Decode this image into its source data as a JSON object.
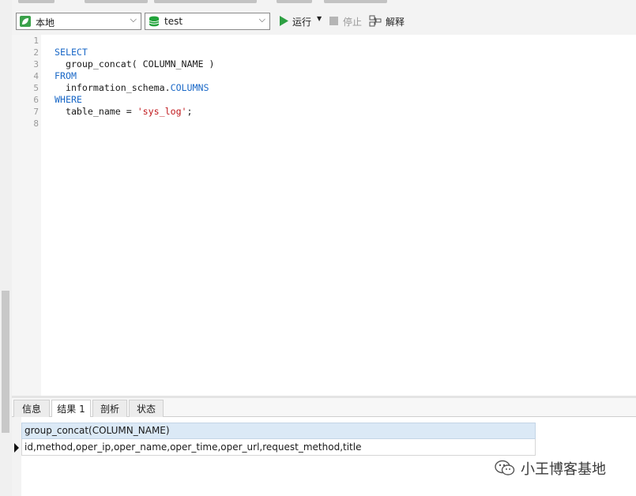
{
  "connection_select": {
    "value": "本地"
  },
  "database_select": {
    "value": "test"
  },
  "toolbar": {
    "run_label": "运行",
    "stop_label": "停止",
    "explain_label": "解释"
  },
  "editor": {
    "line_numbers": [
      "1",
      "2",
      "3",
      "4",
      "5",
      "6",
      "7",
      "8"
    ],
    "lines": {
      "l2_kw": "SELECT",
      "l3_text": "  group_concat( COLUMN_NAME )",
      "l4_kw": "FROM",
      "l5_pre": "  information_schema.",
      "l5_col": "COLUMNS",
      "l6_kw": "WHERE",
      "l7_pre": "  table_name = ",
      "l7_str": "'sys_log'",
      "l7_post": ";"
    }
  },
  "result_tabs": [
    {
      "label": "信息",
      "active": false
    },
    {
      "label": "结果 1",
      "active": true
    },
    {
      "label": "剖析",
      "active": false
    },
    {
      "label": "状态",
      "active": false
    }
  ],
  "result_grid": {
    "columns": [
      "group_concat(COLUMN_NAME)"
    ],
    "rows": [
      [
        "id,method,oper_ip,oper_name,oper_time,oper_url,request_method,title"
      ]
    ]
  },
  "watermark": {
    "text": "小王博客基地"
  },
  "colors": {
    "keyword": "#1a68c7",
    "string": "#c0181c",
    "header_bg": "#dbe9f6",
    "run_icon": "#2ea043"
  }
}
